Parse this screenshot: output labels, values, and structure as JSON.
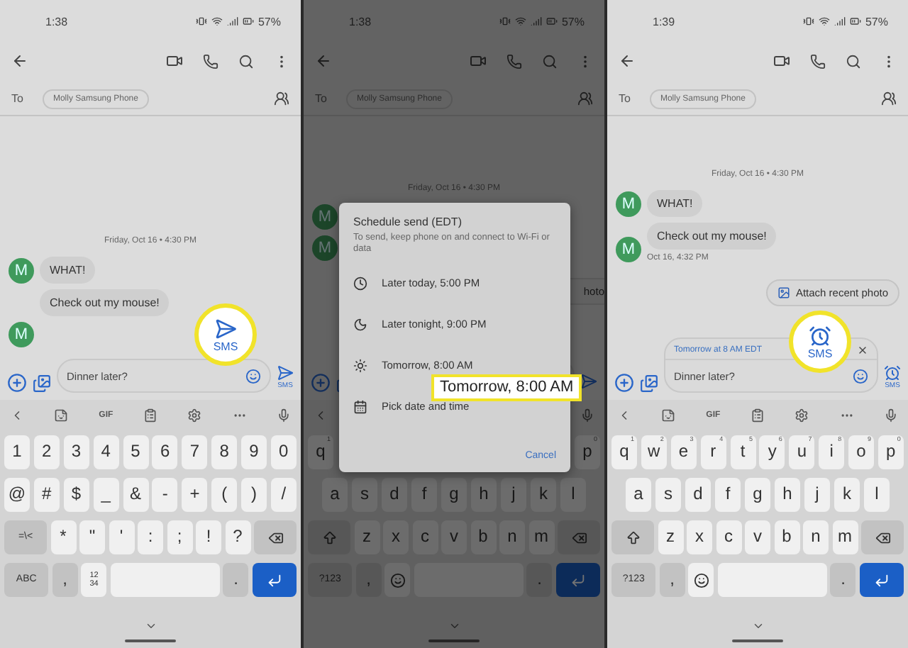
{
  "panels": [
    {
      "dimmed": false,
      "status": {
        "time": "1:38",
        "battery": "57%"
      },
      "recipient": {
        "label": "To",
        "chip": "Molly Samsung Phone"
      },
      "date": "Friday, Oct 16 • 4:30 PM",
      "groups": [
        {
          "avatar": "M",
          "bubbles": [
            "WHAT!"
          ]
        },
        {
          "bubbles": [
            "Check out my mouse!"
          ]
        },
        {
          "avatar": "M"
        }
      ],
      "composer": {
        "value": "Dinner later?",
        "send_label": "SMS"
      },
      "keyboard": {
        "toolbar": [
          {
            "kind": "back"
          },
          {
            "kind": "sticker"
          },
          {
            "kind": "gif",
            "label": "GIF"
          },
          {
            "kind": "clipboard"
          },
          {
            "kind": "settings"
          },
          {
            "kind": "more"
          },
          {
            "kind": "mic"
          }
        ],
        "rows": [
          [
            {
              "kind": "char",
              "label": "1"
            },
            {
              "kind": "char",
              "label": "2"
            },
            {
              "kind": "char",
              "label": "3"
            },
            {
              "kind": "char",
              "label": "4"
            },
            {
              "kind": "char",
              "label": "5"
            },
            {
              "kind": "char",
              "label": "6"
            },
            {
              "kind": "char",
              "label": "7"
            },
            {
              "kind": "char",
              "label": "8"
            },
            {
              "kind": "char",
              "label": "9"
            },
            {
              "kind": "char",
              "label": "0"
            }
          ],
          [
            {
              "kind": "char",
              "label": "@"
            },
            {
              "kind": "char",
              "label": "#"
            },
            {
              "kind": "char",
              "label": "$"
            },
            {
              "kind": "char",
              "label": "_"
            },
            {
              "kind": "char",
              "label": "&"
            },
            {
              "kind": "char",
              "label": "-"
            },
            {
              "kind": "char",
              "label": "+"
            },
            {
              "kind": "char",
              "label": "("
            },
            {
              "kind": "char",
              "label": ")"
            },
            {
              "kind": "char",
              "label": "/"
            }
          ],
          [
            {
              "kind": "mod",
              "label": "=\\<"
            },
            {
              "kind": "char",
              "label": "*"
            },
            {
              "kind": "char",
              "label": "\""
            },
            {
              "kind": "char",
              "label": "'"
            },
            {
              "kind": "char",
              "label": ":"
            },
            {
              "kind": "char",
              "label": ";"
            },
            {
              "kind": "char",
              "label": "!"
            },
            {
              "kind": "char",
              "label": "?"
            },
            {
              "kind": "backspace"
            }
          ],
          [
            {
              "kind": "mod",
              "label": "ABC"
            },
            {
              "kind": "modchar",
              "label": ","
            },
            {
              "kind": "small",
              "label": "12 34"
            },
            {
              "kind": "space"
            },
            {
              "kind": "modchar",
              "label": "."
            },
            {
              "kind": "enter"
            }
          ]
        ]
      },
      "highlight": {
        "kind": "send",
        "label": "SMS"
      }
    },
    {
      "dimmed": true,
      "status": {
        "time": "1:38",
        "battery": "57%"
      },
      "recipient": {
        "label": "To",
        "chip": "Molly Samsung Phone"
      },
      "date": "Friday, Oct 16 • 4:30 PM",
      "groups": [
        {
          "avatar": "M"
        },
        {
          "avatar": "M"
        }
      ],
      "chip_text": "hoto",
      "keyboard": {
        "toolbar": [
          {
            "kind": "back"
          },
          {
            "kind": "mic"
          }
        ],
        "rows": [
          [
            {
              "kind": "char",
              "label": "q",
              "hint": "1"
            },
            {
              "kind": "char",
              "label": "p",
              "hint": "0"
            }
          ],
          [
            {
              "kind": "char",
              "label": "a"
            },
            {
              "kind": "char",
              "label": "s"
            },
            {
              "kind": "char",
              "label": "d"
            },
            {
              "kind": "char",
              "label": "f"
            },
            {
              "kind": "char",
              "label": "g"
            },
            {
              "kind": "char",
              "label": "h"
            },
            {
              "kind": "char",
              "label": "j"
            },
            {
              "kind": "char",
              "label": "k"
            },
            {
              "kind": "char",
              "label": "l"
            }
          ],
          [
            {
              "kind": "shift"
            },
            {
              "kind": "char",
              "label": "z"
            },
            {
              "kind": "char",
              "label": "x"
            },
            {
              "kind": "char",
              "label": "c"
            },
            {
              "kind": "char",
              "label": "v"
            },
            {
              "kind": "char",
              "label": "b"
            },
            {
              "kind": "char",
              "label": "n"
            },
            {
              "kind": "char",
              "label": "m"
            },
            {
              "kind": "backspace"
            }
          ],
          [
            {
              "kind": "mod",
              "label": "?123"
            },
            {
              "kind": "modchar",
              "label": ","
            },
            {
              "kind": "emoji"
            },
            {
              "kind": "space"
            },
            {
              "kind": "modchar",
              "label": "."
            },
            {
              "kind": "enter"
            }
          ]
        ]
      },
      "dialog": {
        "title": "Schedule send (EDT)",
        "subtitle": "To send, keep phone on and connect to Wi-Fi or data",
        "options": [
          {
            "kind": "clock",
            "label": "Later today, 5:00 PM"
          },
          {
            "kind": "moon",
            "label": "Later tonight, 9:00 PM"
          },
          {
            "kind": "sun",
            "label": "Tomorrow, 8:00 AM"
          },
          {
            "kind": "calendar",
            "label": "Pick date and time"
          }
        ],
        "cancel": "Cancel"
      },
      "highlight": {
        "kind": "label",
        "label": "Tomorrow, 8:00 AM"
      }
    },
    {
      "dimmed": false,
      "status": {
        "time": "1:39",
        "battery": "57%"
      },
      "recipient": {
        "label": "To",
        "chip": "Molly Samsung Phone"
      },
      "date": "Friday, Oct 16 • 4:30 PM",
      "groups": [
        {
          "avatar": "M",
          "bubbles": [
            "WHAT!"
          ]
        },
        {
          "avatar": "M",
          "bubbles": [
            "Check out my mouse!"
          ],
          "timestamp": "Oct 16, 4:32 PM"
        }
      ],
      "attach_chip": "Attach recent photo",
      "composer": {
        "value": "Dinner later?",
        "send_label": "SMS",
        "scheduled": "Tomorrow at 8 AM EDT"
      },
      "keyboard": {
        "toolbar": [
          {
            "kind": "back"
          },
          {
            "kind": "sticker"
          },
          {
            "kind": "gif",
            "label": "GIF"
          },
          {
            "kind": "clipboard"
          },
          {
            "kind": "settings"
          },
          {
            "kind": "more"
          },
          {
            "kind": "mic"
          }
        ],
        "rows": [
          [
            {
              "kind": "char",
              "label": "q",
              "hint": "1"
            },
            {
              "kind": "char",
              "label": "w",
              "hint": "2"
            },
            {
              "kind": "char",
              "label": "e",
              "hint": "3"
            },
            {
              "kind": "char",
              "label": "r",
              "hint": "4"
            },
            {
              "kind": "char",
              "label": "t",
              "hint": "5"
            },
            {
              "kind": "char",
              "label": "y",
              "hint": "6"
            },
            {
              "kind": "char",
              "label": "u",
              "hint": "7"
            },
            {
              "kind": "char",
              "label": "i",
              "hint": "8"
            },
            {
              "kind": "char",
              "label": "o",
              "hint": "9"
            },
            {
              "kind": "char",
              "label": "p",
              "hint": "0"
            }
          ],
          [
            {
              "kind": "char",
              "label": "a"
            },
            {
              "kind": "char",
              "label": "s"
            },
            {
              "kind": "char",
              "label": "d"
            },
            {
              "kind": "char",
              "label": "f"
            },
            {
              "kind": "char",
              "label": "g"
            },
            {
              "kind": "char",
              "label": "h"
            },
            {
              "kind": "char",
              "label": "j"
            },
            {
              "kind": "char",
              "label": "k"
            },
            {
              "kind": "char",
              "label": "l"
            }
          ],
          [
            {
              "kind": "shift"
            },
            {
              "kind": "char",
              "label": "z"
            },
            {
              "kind": "char",
              "label": "x"
            },
            {
              "kind": "char",
              "label": "c"
            },
            {
              "kind": "char",
              "label": "v"
            },
            {
              "kind": "char",
              "label": "b"
            },
            {
              "kind": "char",
              "label": "n"
            },
            {
              "kind": "char",
              "label": "m"
            },
            {
              "kind": "backspace"
            }
          ],
          [
            {
              "kind": "mod",
              "label": "?123"
            },
            {
              "kind": "modchar",
              "label": ","
            },
            {
              "kind": "emoji"
            },
            {
              "kind": "space"
            },
            {
              "kind": "modchar",
              "label": "."
            },
            {
              "kind": "enter"
            }
          ]
        ]
      },
      "highlight": {
        "kind": "scheduled",
        "label": "SMS"
      }
    }
  ]
}
